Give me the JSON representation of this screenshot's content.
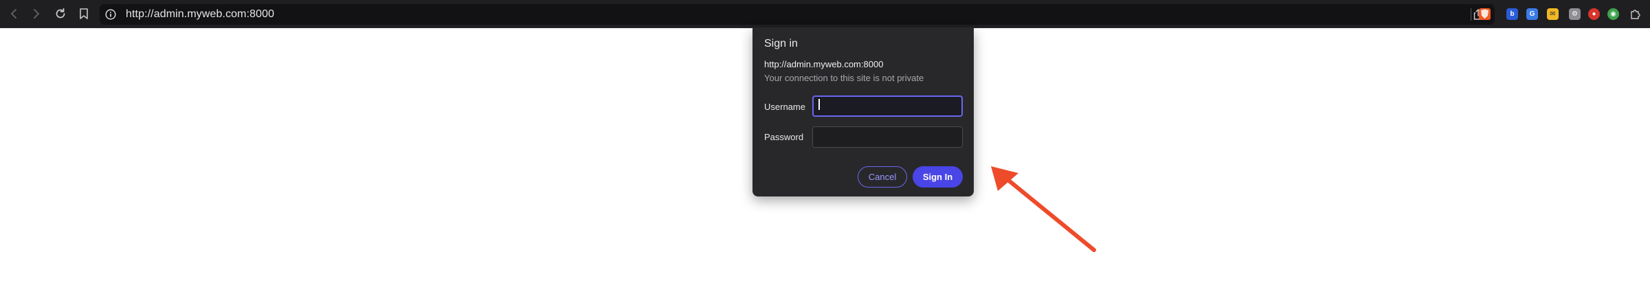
{
  "browser": {
    "url": "http://admin.myweb.com:8000",
    "icons": {
      "back": "back-icon",
      "forward": "forward-icon",
      "reload": "reload-icon",
      "bookmark": "bookmark-icon",
      "site_info": "info-icon",
      "share": "share-icon",
      "extensions": "extensions-icon"
    },
    "colors": {
      "toolbar": "#1f1f22",
      "omnibox": "#121214"
    }
  },
  "dialog": {
    "title": "Sign in",
    "url": "http://admin.myweb.com:8000",
    "note": "Your connection to this site is not private",
    "username_label": "Username",
    "username_value": "",
    "password_label": "Password",
    "password_value": "",
    "cancel_label": "Cancel",
    "signin_label": "Sign In",
    "colors": {
      "accent": "#4945e6",
      "background": "#28282b"
    }
  },
  "annotation": {
    "arrow_color": "#ee4b2b"
  }
}
